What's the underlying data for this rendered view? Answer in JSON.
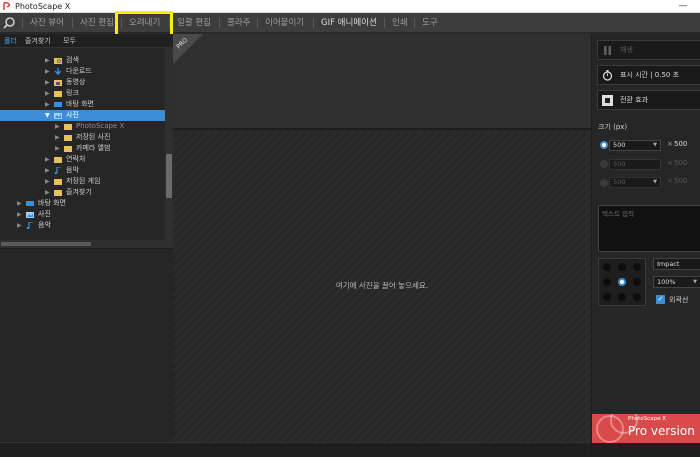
{
  "window": {
    "title": "PhotoScape X",
    "minimize": "—"
  },
  "menu": {
    "items": [
      "사진 뷰어",
      "사진 편집",
      "오려내기",
      "일괄 편집",
      "콜라주",
      "이어붙이기",
      "GIF 애니메이션",
      "인쇄",
      "도구"
    ]
  },
  "left_panel": {
    "tabs": [
      "폴더",
      "즐겨찾기",
      "모두"
    ],
    "tree": [
      {
        "label": "검색",
        "icon": "search-folder-icon",
        "expanded": false
      },
      {
        "label": "다운로드",
        "icon": "download-icon",
        "expanded": false
      },
      {
        "label": "동영상",
        "icon": "video-folder-icon",
        "expanded": false
      },
      {
        "label": "링크",
        "icon": "link-folder-icon",
        "expanded": false
      },
      {
        "label": "바탕 화면",
        "icon": "desktop-icon",
        "expanded": false
      },
      {
        "label": "사진",
        "icon": "pictures-folder-icon",
        "expanded": true,
        "selected": true
      },
      {
        "label": "PhotoScape X",
        "icon": "folder-icon",
        "expanded": false,
        "dim": true
      },
      {
        "label": "저장된 사진",
        "icon": "folder-icon",
        "expanded": false
      },
      {
        "label": "카메라 앨범",
        "icon": "folder-icon",
        "expanded": false
      },
      {
        "label": "연락처",
        "icon": "contacts-folder-icon",
        "expanded": false
      },
      {
        "label": "음악",
        "icon": "music-icon",
        "expanded": false
      },
      {
        "label": "저장된 게임",
        "icon": "folder-icon",
        "expanded": false
      },
      {
        "label": "즐겨찾기",
        "icon": "favorites-folder-icon",
        "expanded": false
      },
      {
        "label": "바탕 화면",
        "icon": "desktop-icon",
        "expanded": false
      },
      {
        "label": "사진",
        "icon": "pictures-folder-icon",
        "expanded": false
      },
      {
        "label": "음악",
        "icon": "music-icon",
        "expanded": false
      }
    ]
  },
  "main": {
    "drop_hint": "여기에 사진을 끌어 놓으세요.",
    "pro_badge": "PRO"
  },
  "right_panel": {
    "play_label": "재생",
    "display_time": "표시 시간 | 0.50 초",
    "transition": "전환 효과",
    "size_title": "크기 (px)",
    "sizes": [
      {
        "width": "500",
        "height": "500",
        "enabled": true,
        "selected": true
      },
      {
        "width": "500",
        "height": "500",
        "enabled": false,
        "selected": false
      },
      {
        "width": "500",
        "height": "500",
        "enabled": false,
        "selected": false
      }
    ],
    "times_sign": "×",
    "text_placeholder": "텍스트 입력",
    "font": "Impact",
    "opacity": "100%",
    "outline_label": "외곽선",
    "outline_checked": true,
    "pro_banner_small": "PhotoScape X",
    "pro_banner_big": "Pro version",
    "accent": "#3c8fd6",
    "banner_color": "#d94a4a",
    "highlight_color": "#f8f000"
  }
}
